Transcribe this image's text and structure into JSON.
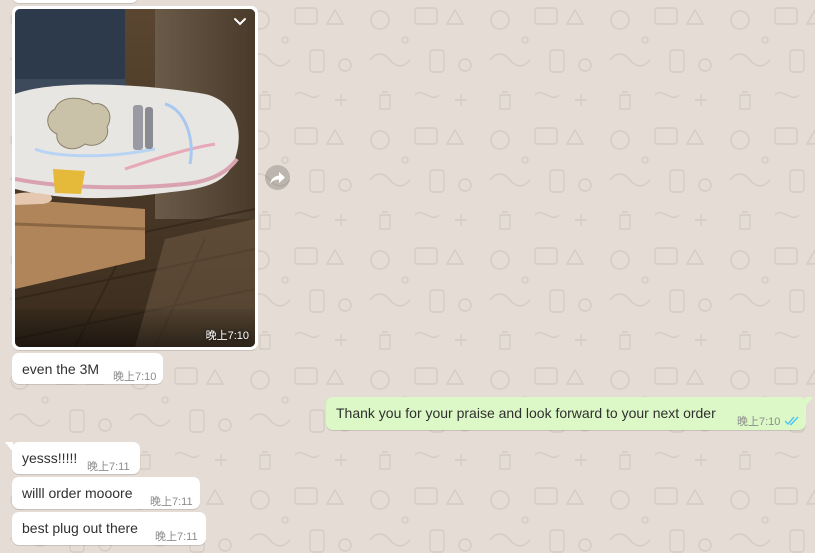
{
  "chat": {
    "image_message": {
      "time": "晚上7:10"
    },
    "messages": [
      {
        "dir": "in",
        "text": "even the 3M",
        "time": "晚上7:10"
      },
      {
        "dir": "out",
        "text": "Thank you for your praise and look forward to your next order",
        "time": "晚上7:10",
        "status": "read"
      },
      {
        "dir": "in",
        "text": "yesss!!!!!",
        "time": "晚上7:11"
      },
      {
        "dir": "in",
        "text": "willl order mooore",
        "time": "晚上7:11"
      },
      {
        "dir": "in",
        "text": "best plug out there",
        "time": "晚上7:11"
      }
    ]
  },
  "colors": {
    "wallpaper": "#e5ddd5",
    "incoming_bubble": "#ffffff",
    "outgoing_bubble": "#dcf8c6",
    "read_ticks": "#4fc3f7"
  },
  "icons": {
    "menu": "chevron-down-icon",
    "forward": "forward-icon",
    "status": "double-check-icon"
  }
}
